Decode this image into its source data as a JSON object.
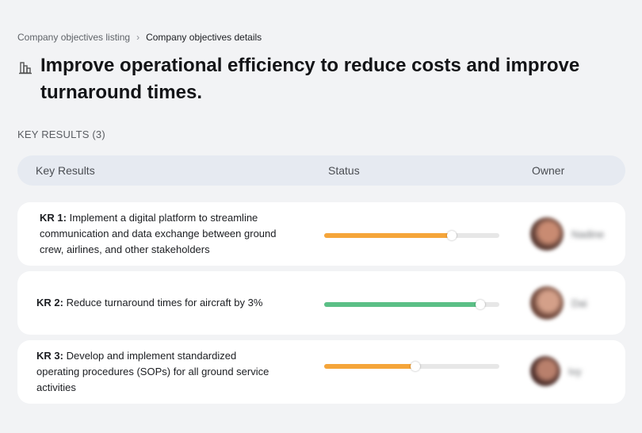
{
  "breadcrumb": {
    "parent": "Company objectives listing",
    "separator": "›",
    "current": "Company objectives details"
  },
  "objective": {
    "title": "Improve operational efficiency to reduce costs and improve turnaround times.",
    "icon": "building-chart-icon"
  },
  "key_results_section": {
    "label": "KEY RESULTS (3)"
  },
  "table_header": {
    "key_results": "Key Results",
    "status": "Status",
    "owner": "Owner"
  },
  "key_results": [
    {
      "label": "KR 1:",
      "text": "Implement a digital platform to streamline communication and data exchange between ground crew, airlines, and other stakeholders",
      "progress": 0.73,
      "progress_color": "#f5a53a",
      "owner_name": "Nadine",
      "avatar_colors": [
        "#5a3a32",
        "#c98b72"
      ]
    },
    {
      "label": "KR 2:",
      "text": "Reduce turnaround times for aircraft by 3%",
      "progress": 0.89,
      "progress_color": "#5bbf86",
      "owner_name": "Dai",
      "avatar_colors": [
        "#6b4438",
        "#d4a089"
      ]
    },
    {
      "label": "KR 3:",
      "text": "Develop and implement standardized operating procedures (SOPs) for all ground service activities",
      "progress": 0.52,
      "progress_color": "#f5a53a",
      "owner_name": "Ivy",
      "avatar_colors": [
        "#4a2c28",
        "#b9806c"
      ]
    }
  ]
}
